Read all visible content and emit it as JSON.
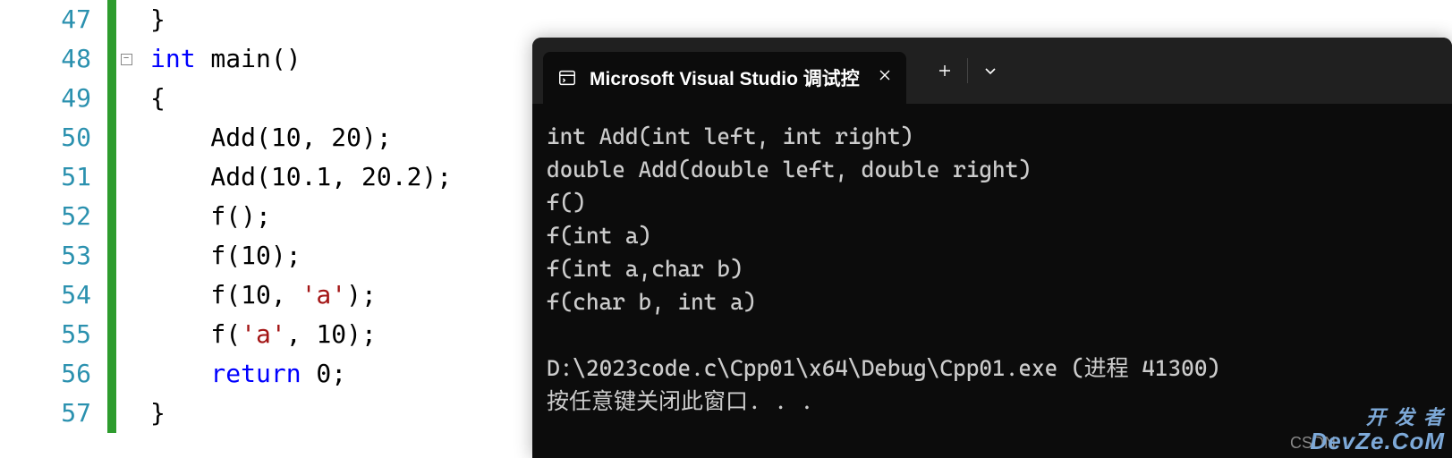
{
  "editor": {
    "lines": [
      {
        "num": "47",
        "fold": "",
        "indent": 0,
        "tokens": [
          {
            "t": "brace",
            "v": "}"
          }
        ]
      },
      {
        "num": "48",
        "fold": "-",
        "indent": 0,
        "tokens": [
          {
            "t": "kw",
            "v": "int"
          },
          {
            "t": "plain",
            "v": " main()"
          }
        ]
      },
      {
        "num": "49",
        "fold": "",
        "indent": 0,
        "tokens": [
          {
            "t": "brace",
            "v": "{"
          }
        ]
      },
      {
        "num": "50",
        "fold": "",
        "indent": 1,
        "tokens": [
          {
            "t": "plain",
            "v": "    Add(10, 20);"
          }
        ]
      },
      {
        "num": "51",
        "fold": "",
        "indent": 1,
        "tokens": [
          {
            "t": "plain",
            "v": "    Add(10.1, 20.2);"
          }
        ]
      },
      {
        "num": "52",
        "fold": "",
        "indent": 1,
        "tokens": [
          {
            "t": "plain",
            "v": "    f();"
          }
        ]
      },
      {
        "num": "53",
        "fold": "",
        "indent": 1,
        "tokens": [
          {
            "t": "plain",
            "v": "    f(10);"
          }
        ]
      },
      {
        "num": "54",
        "fold": "",
        "indent": 1,
        "tokens": [
          {
            "t": "plain",
            "v": "    f(10, "
          },
          {
            "t": "char",
            "v": "'a'"
          },
          {
            "t": "plain",
            "v": ");"
          }
        ]
      },
      {
        "num": "55",
        "fold": "",
        "indent": 1,
        "tokens": [
          {
            "t": "plain",
            "v": "    f("
          },
          {
            "t": "char",
            "v": "'a'"
          },
          {
            "t": "plain",
            "v": ", 10);"
          }
        ]
      },
      {
        "num": "56",
        "fold": "",
        "indent": 1,
        "tokens": [
          {
            "t": "kw",
            "v": "    return"
          },
          {
            "t": "plain",
            "v": " 0;"
          }
        ]
      },
      {
        "num": "57",
        "fold": "",
        "indent": 0,
        "tokens": [
          {
            "t": "brace",
            "v": "}"
          }
        ]
      }
    ]
  },
  "terminal": {
    "tab_title": "Microsoft Visual Studio 调试控",
    "output": [
      "int Add(int left, int right)",
      "double Add(double left, double right)",
      "f()",
      "f(int a)",
      "f(int a,char b)",
      "f(char b, int a)",
      "",
      "D:\\2023code.c\\Cpp01\\x64\\Debug\\Cpp01.exe (进程 41300)",
      "按任意键关闭此窗口. . ."
    ]
  },
  "watermark": {
    "csdn_label": "CSDN",
    "line1": "开 发 者",
    "line2": "DevZe.CoM"
  }
}
